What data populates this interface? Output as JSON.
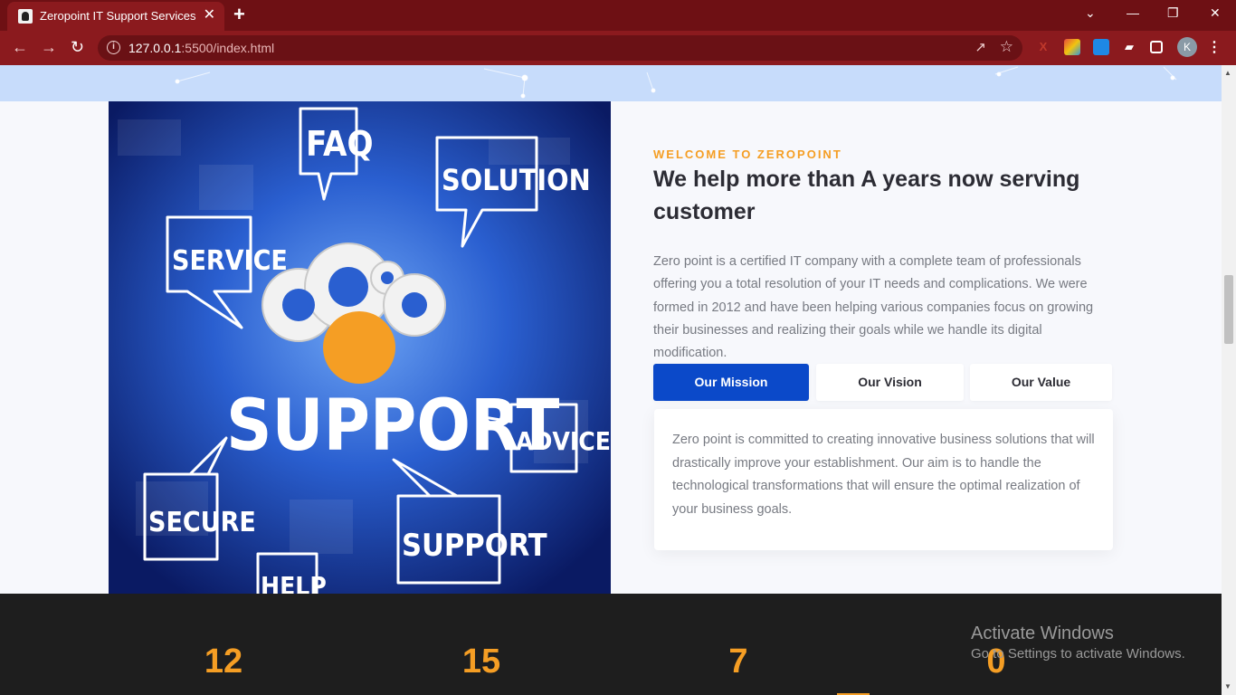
{
  "browser": {
    "tab_title": "Zeropoint IT Support Services",
    "tab_close": "✕",
    "new_tab": "+",
    "url_host": "127.0.0.1",
    "url_path": ":5500/index.html",
    "profile_initial": "K",
    "window_controls": [
      "⌄",
      "—",
      "❐",
      "✕"
    ]
  },
  "image": {
    "words": {
      "faq": "FAQ",
      "solution": "SOLUTION",
      "service": "SERVICE",
      "support": "SUPPORT",
      "advice": "ADVICE",
      "secure": "SECURE",
      "support2": "SUPPORT",
      "help": "HELP"
    }
  },
  "about": {
    "eyebrow": "WELCOME TO ZEROPOINT",
    "headline": "We help more than A years now serving customer",
    "intro": "Zero point is a certified IT company with a complete team of professionals offering you a total resolution of your IT needs and complications. We were formed in 2012 and have been helping various companies focus on growing their businesses and realizing their goals while we handle its digital modification.",
    "tabs": [
      "Our Mission",
      "Our Vision",
      "Our Value"
    ],
    "active_tab": "Our Mission",
    "panel_text": "Zero point is committed to creating innovative business solutions that will drastically improve your establishment. Our aim is to handle the technological transformations that will ensure the optimal realization of your business goals."
  },
  "stats": [
    "12",
    "15",
    "7",
    "0"
  ],
  "watermark": {
    "title": "Activate Windows",
    "subtitle": "Go to Settings to activate Windows."
  },
  "colors": {
    "accent": "#f59e24",
    "primary": "#0b49c9",
    "chrome": "#8b1a1e",
    "stats_bg": "#1e1e1e"
  }
}
